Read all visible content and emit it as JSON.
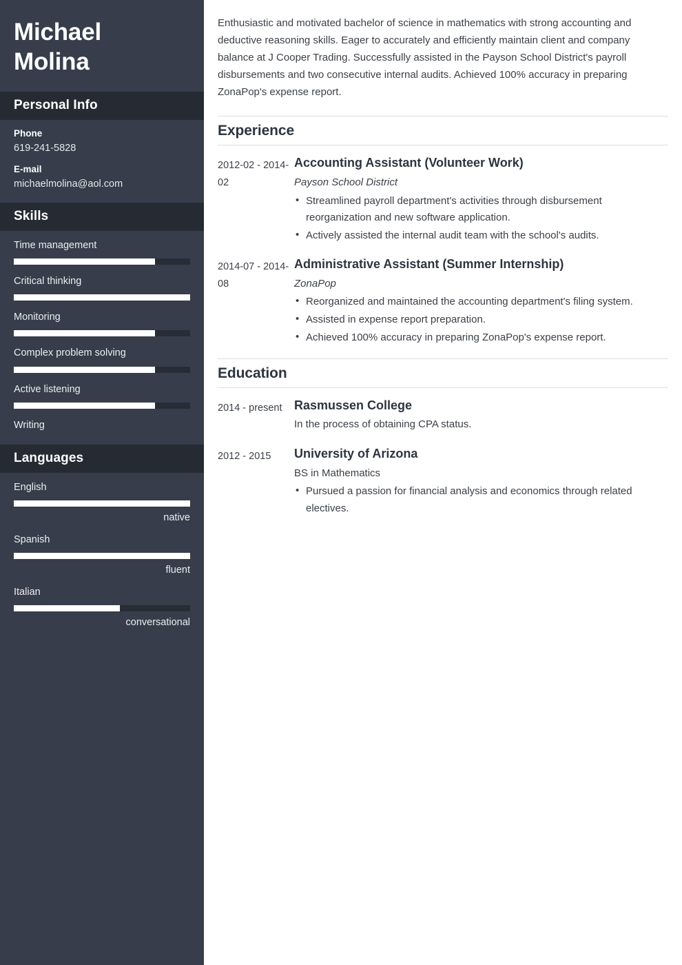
{
  "theme": {
    "sidebar_bg": "#373d4a",
    "sidebar_band_bg": "#252a33",
    "bar_track": "#272c36",
    "bar_fill": "#ffffff",
    "page_bg": "#ffffff",
    "body_text": "#3b3f46",
    "heading_text": "#2e3440",
    "rule": "#dcdee1"
  },
  "sidebar": {
    "name_first": "Michael",
    "name_last": "Molina",
    "sections": {
      "personal_info": {
        "title": "Personal Info",
        "fields": [
          {
            "label": "Phone",
            "value": "619-241-5828"
          },
          {
            "label": "E-mail",
            "value": "michaelmolina@aol.com"
          }
        ]
      },
      "skills": {
        "title": "Skills",
        "items": [
          {
            "label": "Time management",
            "level": 80,
            "has_bar": true
          },
          {
            "label": "Critical thinking",
            "level": 100,
            "has_bar": true
          },
          {
            "label": "Monitoring",
            "level": 80,
            "has_bar": true
          },
          {
            "label": "Complex problem solving",
            "level": 80,
            "has_bar": true
          },
          {
            "label": "Active listening",
            "level": 80,
            "has_bar": true
          },
          {
            "label": "Writing",
            "level": 0,
            "has_bar": false
          }
        ]
      },
      "languages": {
        "title": "Languages",
        "items": [
          {
            "label": "English",
            "level": 100,
            "note": "native",
            "has_bar": true
          },
          {
            "label": "Spanish",
            "level": 100,
            "note": "fluent",
            "has_bar": true
          },
          {
            "label": "Italian",
            "level": 60,
            "note": "conversational",
            "has_bar": true
          }
        ]
      }
    }
  },
  "main": {
    "summary": "Enthusiastic and motivated bachelor of science in mathematics with strong accounting and deductive reasoning skills. Eager to accurately and efficiently maintain client and company balance at J Cooper Trading. Successfully assisted in the Payson School District's payroll disbursements and two consecutive internal audits. Achieved 100% accuracy in preparing ZonaPop's expense report.",
    "experience": {
      "title": "Experience",
      "entries": [
        {
          "date": "2012-02 - 2014-02",
          "title": "Accounting Assistant (Volunteer Work)",
          "org": "Payson School District",
          "bullets": [
            "Streamlined payroll department's activities through disbursement reorganization and new software application.",
            "Actively assisted the internal audit team with the school's audits."
          ]
        },
        {
          "date": "2014-07 - 2014-08",
          "title": "Administrative Assistant (Summer Internship)",
          "org": "ZonaPop",
          "bullets": [
            "Reorganized and maintained the accounting department's filing system.",
            "Assisted in expense report preparation.",
            "Achieved 100% accuracy in preparing ZonaPop's expense report."
          ]
        }
      ]
    },
    "education": {
      "title": "Education",
      "entries": [
        {
          "date": "2014 - present",
          "title": "Rasmussen College",
          "org": "In the process of obtaining CPA status.",
          "bullets": []
        },
        {
          "date": "2012 - 2015",
          "title": "University of Arizona",
          "org": "BS in Mathematics",
          "bullets": [
            "Pursued a passion for financial analysis and economics through related electives."
          ]
        }
      ]
    }
  }
}
